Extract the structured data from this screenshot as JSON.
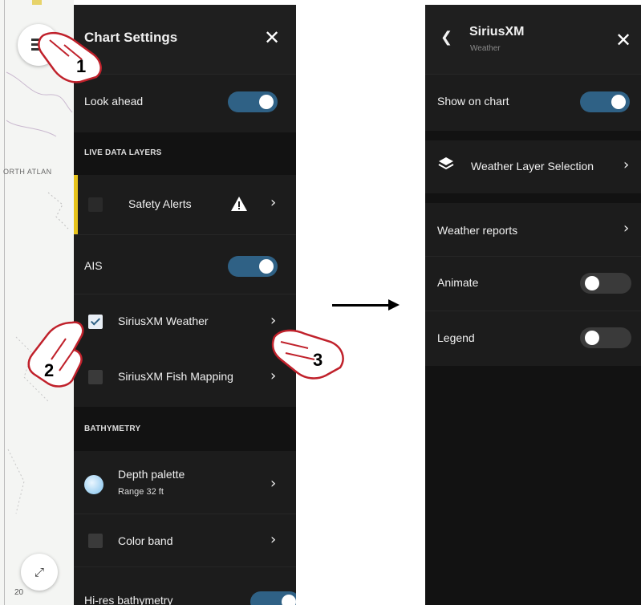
{
  "map": {
    "region_label": "ORTH ATLAN",
    "scale_text": "20"
  },
  "chart_settings": {
    "title": "Chart Settings",
    "close_glyph": "✕",
    "look_ahead_label": "Look ahead",
    "live_data_layers_header": "LIVE DATA LAYERS",
    "safety_alerts_label": "Safety Alerts",
    "ais_label": "AIS",
    "siriusxm_weather_label": "SiriusXM Weather",
    "siriusxm_fish_label": "SiriusXM Fish Mapping",
    "bathymetry_header": "BATHYMETRY",
    "depth_palette_label": "Depth palette",
    "depth_palette_range": "Range 32 ft",
    "color_band_label": "Color band",
    "hires_label": "Hi-res bathymetry"
  },
  "siriusxm": {
    "title": "SiriusXM",
    "subtitle": "Weather",
    "back_glyph": "❮",
    "close_glyph": "✕",
    "show_on_chart_label": "Show on chart",
    "weather_layer_label": "Weather Layer Selection",
    "weather_reports_label": "Weather reports",
    "animate_label": "Animate",
    "legend_label": "Legend"
  },
  "callouts": [
    "1",
    "2",
    "3"
  ],
  "colors": {
    "panel_bg": "#1c1c1c",
    "toggle_on": "#2f6185",
    "safety_accent": "#e6c21a"
  },
  "icons": [
    "menu-icon",
    "expand-icon",
    "warning-icon",
    "layers-icon",
    "chevron-right-icon",
    "back-chevron-icon",
    "close-icon",
    "tap-hand-icon"
  ]
}
